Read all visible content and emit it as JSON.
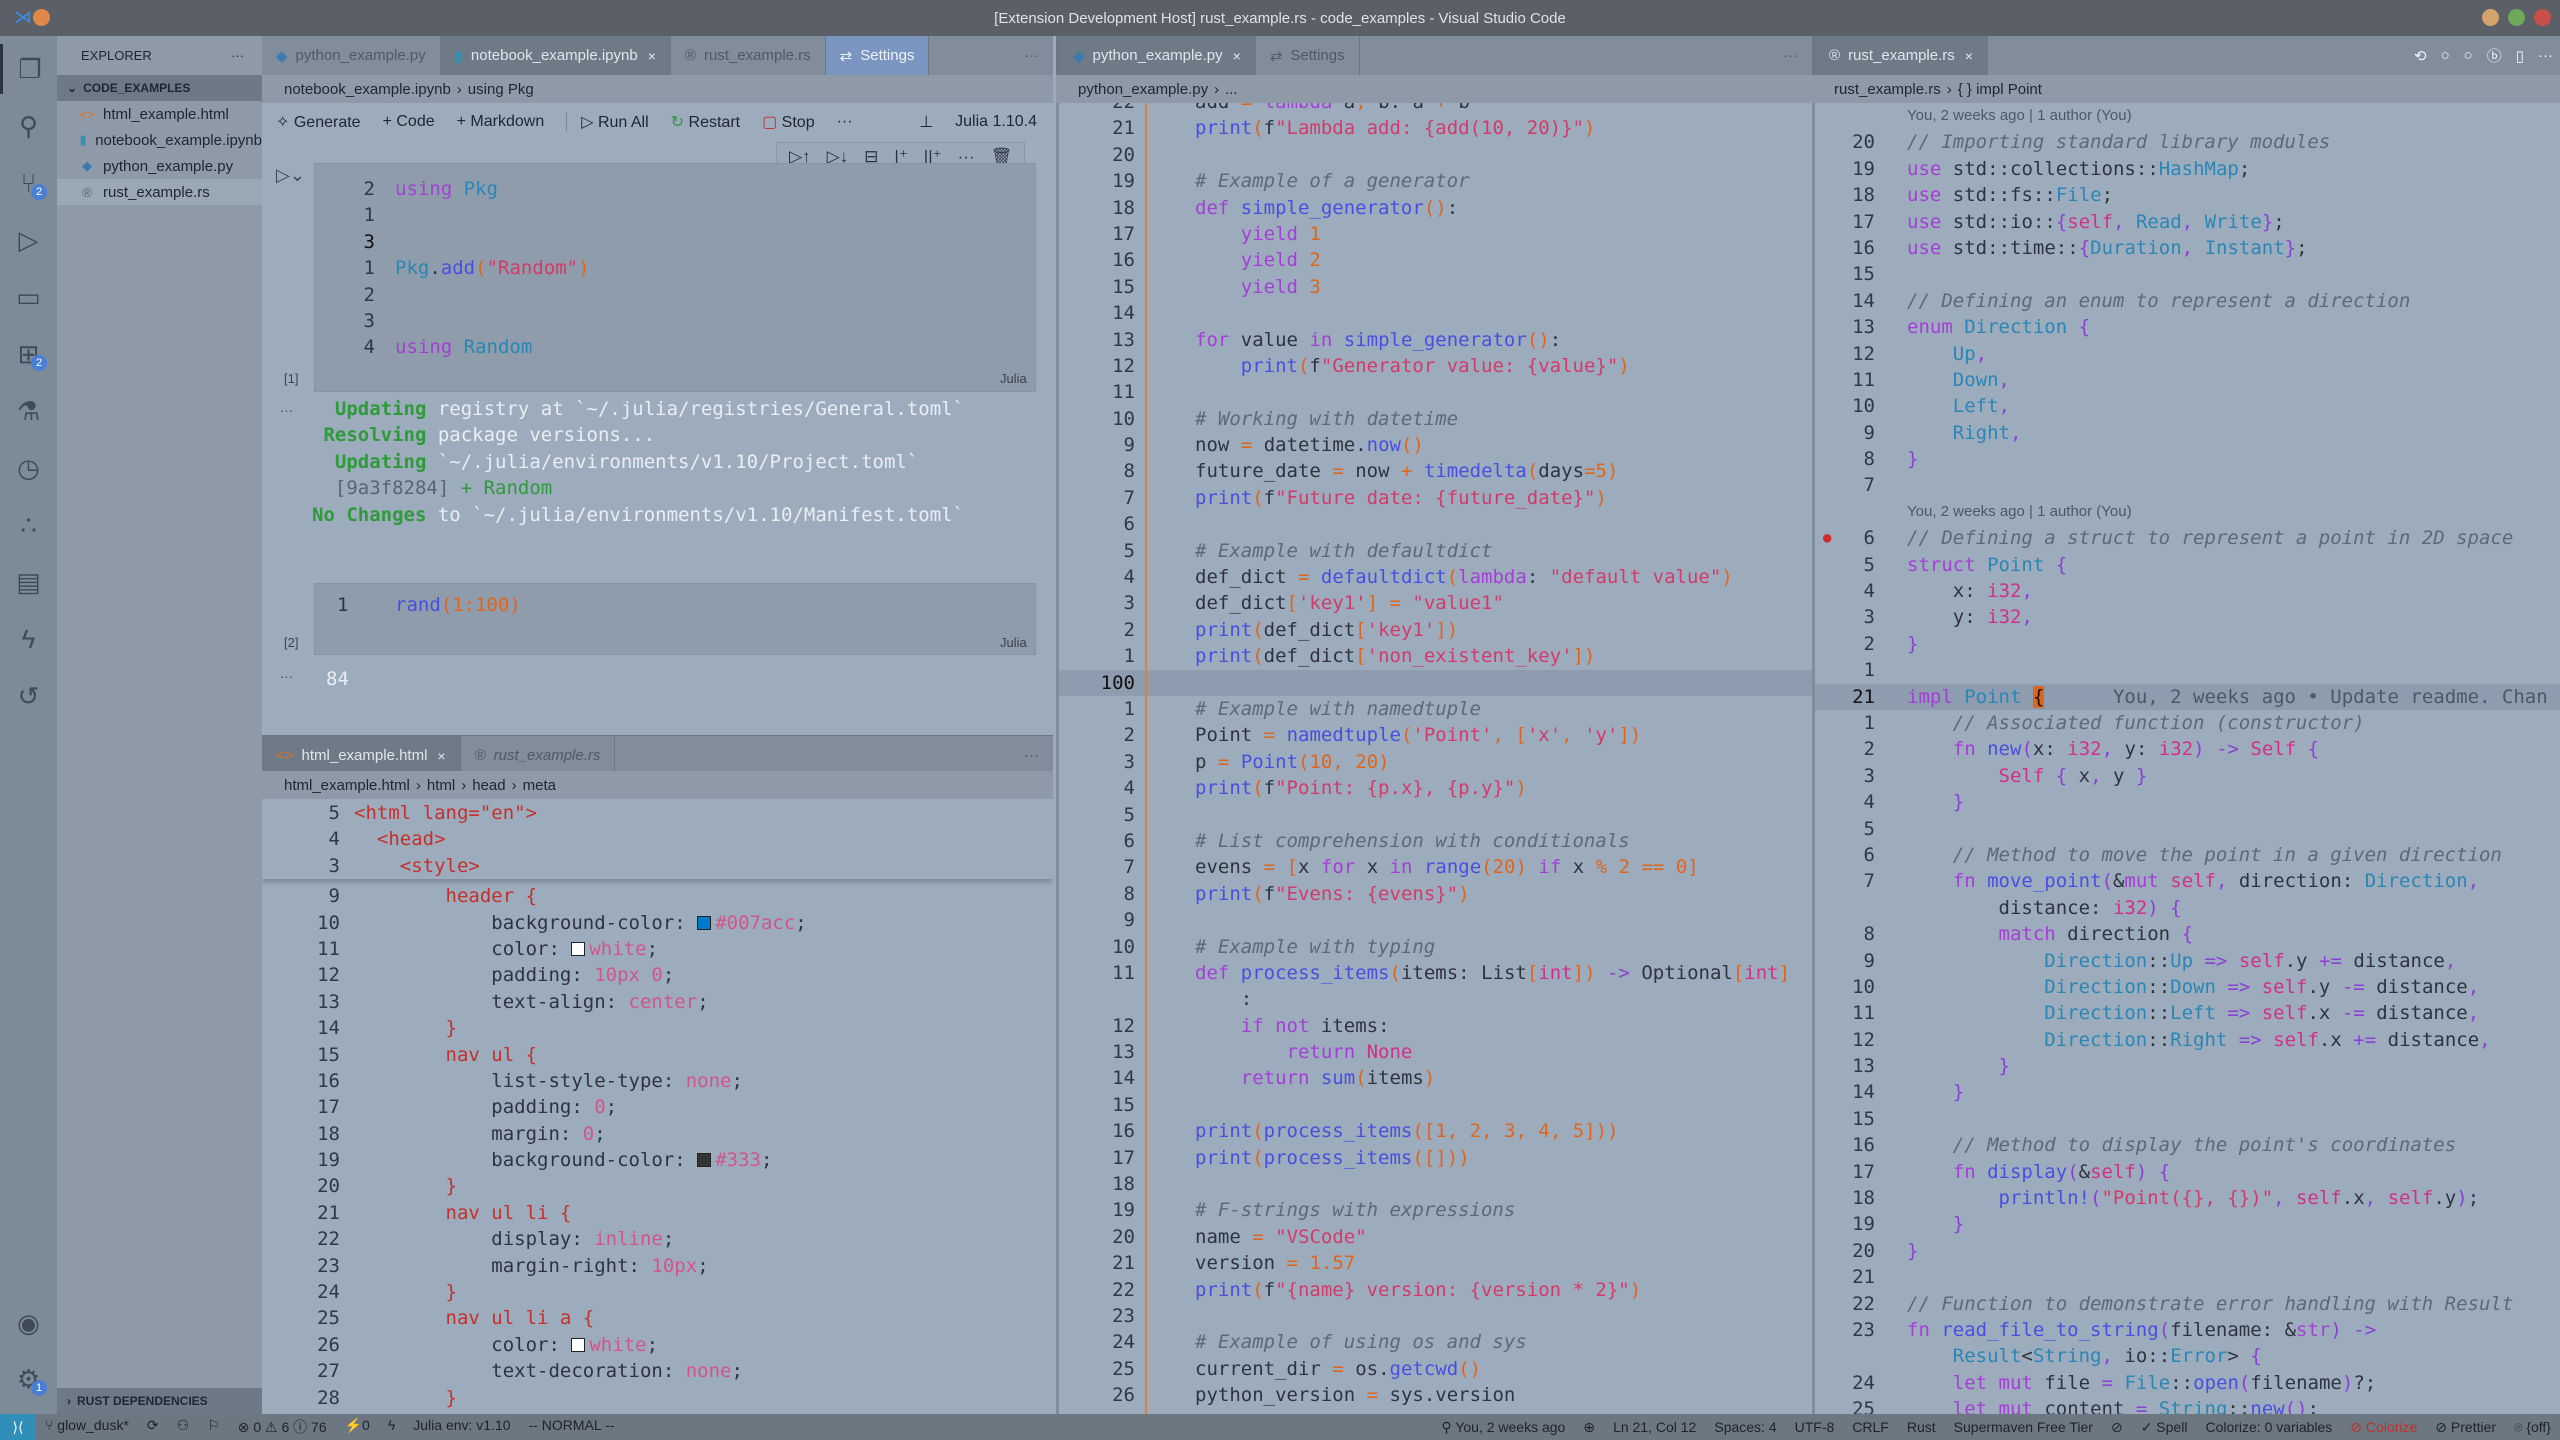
{
  "window": {
    "title": "[Extension Development Host] rust_example.rs - code_examples - Visual Studio Code"
  },
  "activity_bar": {
    "items": [
      "explorer-icon",
      "search-icon",
      "source-control-icon",
      "run-debug-icon",
      "remote-explorer-icon",
      "extensions-icon",
      "testing-icon",
      "timeline-icon",
      "julia-icon",
      "terminal-icon",
      "lightning-icon",
      "history-icon"
    ],
    "scm_badge": "2",
    "ext_badge": "2",
    "settings_badge": "1"
  },
  "sidebar": {
    "title": "EXPLORER",
    "more": "···",
    "section": "CODE_EXAMPLES",
    "files": [
      {
        "name": "html_example.html",
        "icon": "<>",
        "color": "#e07020"
      },
      {
        "name": "notebook_example.ipynb",
        "icon": "▮",
        "color": "#3a8fb0"
      },
      {
        "name": "python_example.py",
        "icon": "◆",
        "color": "#3a7ab0"
      },
      {
        "name": "rust_example.rs",
        "icon": "®",
        "color": "#5d6570"
      }
    ],
    "footer": "RUST DEPENDENCIES"
  },
  "notebook_group": {
    "tabs": [
      {
        "label": "python_example.py",
        "icon": "◆"
      },
      {
        "label": "notebook_example.ipynb",
        "icon": "▮",
        "close": "×"
      },
      {
        "label": "rust_example.rs",
        "icon": "®"
      },
      {
        "label": "Settings",
        "icon": "⇄"
      }
    ],
    "more": "···",
    "breadcrumb": [
      "notebook_example.ipynb",
      "›",
      "using Pkg"
    ],
    "toolbar": {
      "generate": "Generate",
      "code": "+ Code",
      "markdown": "+ Markdown",
      "run_all": "Run All",
      "restart": "Restart",
      "stop": "Stop",
      "more": "···",
      "kernel": "Julia 1.10.4"
    },
    "cell_toolbar": [
      "▷↑",
      "▷↓",
      "⊟",
      "|⁺",
      "||⁺",
      "···",
      "🗑"
    ],
    "cell1": {
      "exec": "[1]",
      "lang": "Julia",
      "lines": [
        {
          "n": "2",
          "t": "using Pkg"
        },
        {
          "n": "1",
          "t": ""
        },
        {
          "n": "3",
          "t": "",
          "cur": true
        },
        {
          "n": "1",
          "t": "Pkg.add(\"Random\")"
        },
        {
          "n": "2",
          "t": ""
        },
        {
          "n": "3",
          "t": ""
        },
        {
          "n": "4",
          "t": "using Random"
        }
      ]
    },
    "output1": [
      {
        "label": "  Updating",
        "text": " registry at `~/.julia/registries/General.toml`"
      },
      {
        "label": " Resolving",
        "text": " package versions..."
      },
      {
        "label": "  Updating",
        "text": " `~/.julia/environments/v1.10/Project.toml`"
      },
      {
        "hash": "  [9a3f8284]",
        "add": " + Random"
      },
      {
        "label": "No Changes",
        "text": " to `~/.julia/environments/v1.10/Manifest.toml`"
      }
    ],
    "cell2": {
      "exec": "[2]",
      "lang": "Julia",
      "line_no": "1",
      "fn": "rand",
      "args": "1:100"
    },
    "output2": "84"
  },
  "html_group": {
    "tabs": [
      {
        "label": "html_example.html",
        "icon": "<>",
        "close": "×"
      },
      {
        "label": "rust_example.rs",
        "icon": "®"
      }
    ],
    "more": "···",
    "breadcrumb": [
      "html_example.html",
      "›",
      "html",
      "›",
      "head",
      "›",
      "meta"
    ],
    "sticky": [
      {
        "n": "5",
        "t": "<html lang=\"en\">"
      },
      {
        "n": "4",
        "t": "  <head>"
      },
      {
        "n": "3",
        "t": "    <style>"
      }
    ],
    "lines": [
      {
        "n": "9",
        "t": "        header {"
      },
      {
        "n": "10",
        "t": "            background-color: #007acc;",
        "sw": "#007acc"
      },
      {
        "n": "11",
        "t": "            color: white;",
        "sw": "#ffffff"
      },
      {
        "n": "12",
        "t": "            padding: 10px 0;"
      },
      {
        "n": "13",
        "t": "            text-align: center;"
      },
      {
        "n": "14",
        "t": "        }"
      },
      {
        "n": "15",
        "t": "        nav ul {"
      },
      {
        "n": "16",
        "t": "            list-style-type: none;"
      },
      {
        "n": "17",
        "t": "            padding: 0;"
      },
      {
        "n": "18",
        "t": "            margin: 0;"
      },
      {
        "n": "19",
        "t": "            background-color: #333;",
        "sw": "#333333"
      },
      {
        "n": "20",
        "t": "        }"
      },
      {
        "n": "21",
        "t": "        nav ul li {"
      },
      {
        "n": "22",
        "t": "            display: inline;"
      },
      {
        "n": "23",
        "t": "            margin-right: 10px;"
      },
      {
        "n": "24",
        "t": "        }"
      },
      {
        "n": "25",
        "t": "        nav ul li a {"
      },
      {
        "n": "26",
        "t": "            color: white;",
        "sw": "#ffffff"
      },
      {
        "n": "27",
        "t": "            text-decoration: none;"
      },
      {
        "n": "28",
        "t": "        }"
      }
    ]
  },
  "python_group": {
    "tabs": [
      {
        "label": "python_example.py",
        "icon": "◆",
        "close": "×"
      },
      {
        "label": "Settings",
        "icon": "⇄"
      }
    ],
    "more": "···",
    "breadcrumb": [
      "python_example.py",
      "›",
      "..."
    ],
    "lines": [
      {
        "n": "22",
        "t": "add = lambda a, b: a + b"
      },
      {
        "n": "21",
        "t": "print(f\"Lambda add: {add(10, 20)}\")"
      },
      {
        "n": "20",
        "t": ""
      },
      {
        "n": "19",
        "t": "# Example of a generator"
      },
      {
        "n": "18",
        "t": "def simple_generator():"
      },
      {
        "n": "17",
        "t": "    yield 1"
      },
      {
        "n": "16",
        "t": "    yield 2"
      },
      {
        "n": "15",
        "t": "    yield 3"
      },
      {
        "n": "14",
        "t": ""
      },
      {
        "n": "13",
        "t": "for value in simple_generator():"
      },
      {
        "n": "12",
        "t": "    print(f\"Generator value: {value}\")"
      },
      {
        "n": "11",
        "t": ""
      },
      {
        "n": "10",
        "t": "# Working with datetime"
      },
      {
        "n": "9",
        "t": "now = datetime.now()"
      },
      {
        "n": "8",
        "t": "future_date = now + timedelta(days=5)"
      },
      {
        "n": "7",
        "t": "print(f\"Future date: {future_date}\")"
      },
      {
        "n": "6",
        "t": ""
      },
      {
        "n": "5",
        "t": "# Example with defaultdict"
      },
      {
        "n": "4",
        "t": "def_dict = defaultdict(lambda: \"default value\")"
      },
      {
        "n": "3",
        "t": "def_dict['key1'] = \"value1\""
      },
      {
        "n": "2",
        "t": "print(def_dict['key1'])"
      },
      {
        "n": "1",
        "t": "print(def_dict['non_existent_key'])"
      },
      {
        "n": "100",
        "t": "",
        "cur": true
      },
      {
        "n": "1",
        "t": "# Example with namedtuple"
      },
      {
        "n": "2",
        "t": "Point = namedtuple('Point', ['x', 'y'])"
      },
      {
        "n": "3",
        "t": "p = Point(10, 20)"
      },
      {
        "n": "4",
        "t": "print(f\"Point: {p.x}, {p.y}\")"
      },
      {
        "n": "5",
        "t": ""
      },
      {
        "n": "6",
        "t": "# List comprehension with conditionals"
      },
      {
        "n": "7",
        "t": "evens = [x for x in range(20) if x % 2 == 0]"
      },
      {
        "n": "8",
        "t": "print(f\"Evens: {evens}\")"
      },
      {
        "n": "9",
        "t": ""
      },
      {
        "n": "10",
        "t": "# Example with typing"
      },
      {
        "n": "11",
        "t": "def process_items(items: List[int]) -> Optional[int]"
      },
      {
        "n": "",
        "t": "    :"
      },
      {
        "n": "12",
        "t": "    if not items:"
      },
      {
        "n": "13",
        "t": "        return None"
      },
      {
        "n": "14",
        "t": "    return sum(items)"
      },
      {
        "n": "15",
        "t": ""
      },
      {
        "n": "16",
        "t": "print(process_items([1, 2, 3, 4, 5]))"
      },
      {
        "n": "17",
        "t": "print(process_items([]))"
      },
      {
        "n": "18",
        "t": ""
      },
      {
        "n": "19",
        "t": "# F-strings with expressions"
      },
      {
        "n": "20",
        "t": "name = \"VSCode\""
      },
      {
        "n": "21",
        "t": "version = 1.57"
      },
      {
        "n": "22",
        "t": "print(f\"{name} version: {version * 2}\")"
      },
      {
        "n": "23",
        "t": ""
      },
      {
        "n": "24",
        "t": "# Example of using os and sys"
      },
      {
        "n": "25",
        "t": "current_dir = os.getcwd()"
      },
      {
        "n": "26",
        "t": "python_version = sys.version"
      }
    ]
  },
  "rust_group": {
    "tabs": [
      {
        "label": "rust_example.rs",
        "icon": "®",
        "close": "×"
      }
    ],
    "actions": [
      "⟲",
      "○",
      "○",
      "ⓑ",
      "▯",
      "···"
    ],
    "breadcrumb": [
      "rust_example.rs",
      "›",
      "{ } impl Point"
    ],
    "lines": [
      {
        "lens": "You, 2 weeks ago | 1 author (You)"
      },
      {
        "n": "20",
        "t": "// Importing standard library modules"
      },
      {
        "n": "19",
        "t": "use std::collections::HashMap;"
      },
      {
        "n": "18",
        "t": "use std::fs::File;"
      },
      {
        "n": "17",
        "t": "use std::io::{self, Read, Write};"
      },
      {
        "n": "16",
        "t": "use std::time::{Duration, Instant};"
      },
      {
        "n": "15",
        "t": ""
      },
      {
        "n": "14",
        "t": "// Defining an enum to represent a direction"
      },
      {
        "n": "13",
        "t": "enum Direction {"
      },
      {
        "n": "12",
        "t": "    Up,"
      },
      {
        "n": "11",
        "t": "    Down,"
      },
      {
        "n": "10",
        "t": "    Left,"
      },
      {
        "n": "9",
        "t": "    Right,"
      },
      {
        "n": "8",
        "t": "}"
      },
      {
        "n": "7",
        "t": ""
      },
      {
        "lens": "You, 2 weeks ago | 1 author (You)"
      },
      {
        "n": "6",
        "t": "// Defining a struct to represent a point in 2D space",
        "bp": true
      },
      {
        "n": "5",
        "t": "struct Point {"
      },
      {
        "n": "4",
        "t": "    x: i32,"
      },
      {
        "n": "3",
        "t": "    y: i32,"
      },
      {
        "n": "2",
        "t": "}"
      },
      {
        "n": "1",
        "t": ""
      },
      {
        "n": "21",
        "t": "impl Point {",
        "cur": true,
        "blame": "You, 2 weeks ago • Update readme. Chan"
      },
      {
        "n": "1",
        "t": "    // Associated function (constructor)"
      },
      {
        "n": "2",
        "t": "    fn new(x: i32, y: i32) -> Self {"
      },
      {
        "n": "3",
        "t": "        Self { x, y }"
      },
      {
        "n": "4",
        "t": "    }"
      },
      {
        "n": "5",
        "t": ""
      },
      {
        "n": "6",
        "t": "    // Method to move the point in a given direction"
      },
      {
        "n": "7",
        "t": "    fn move_point(&mut self, direction: Direction,"
      },
      {
        "n": "",
        "t": "        distance: i32) {"
      },
      {
        "n": "8",
        "t": "        match direction {"
      },
      {
        "n": "9",
        "t": "            Direction::Up => self.y += distance,"
      },
      {
        "n": "10",
        "t": "            Direction::Down => self.y -= distance,"
      },
      {
        "n": "11",
        "t": "            Direction::Left => self.x -= distance,"
      },
      {
        "n": "12",
        "t": "            Direction::Right => self.x += distance,"
      },
      {
        "n": "13",
        "t": "        }"
      },
      {
        "n": "14",
        "t": "    }"
      },
      {
        "n": "15",
        "t": ""
      },
      {
        "n": "16",
        "t": "    // Method to display the point's coordinates"
      },
      {
        "n": "17",
        "t": "    fn display(&self) {"
      },
      {
        "n": "18",
        "t": "        println!(\"Point({}, {})\", self.x, self.y);"
      },
      {
        "n": "19",
        "t": "    }"
      },
      {
        "n": "20",
        "t": "}"
      },
      {
        "n": "21",
        "t": ""
      },
      {
        "n": "22",
        "t": "// Function to demonstrate error handling with Result"
      },
      {
        "n": "23",
        "t": "fn read_file_to_string(filename: &str) ->"
      },
      {
        "n": "",
        "t": "    Result<String, io::Error> {"
      },
      {
        "n": "24",
        "t": "    let mut file = File::open(filename)?;"
      },
      {
        "n": "25",
        "t": "    let mut content = String::new();"
      }
    ]
  },
  "statusbar": {
    "remote": "⟩⟨",
    "left": [
      "⑂ glow_dusk*",
      "⟳",
      "⚇",
      "⚐",
      "⊗ 0 ⚠ 6 ⓘ 76",
      "⚡0",
      "ϟ",
      "Julia env: v1.10",
      "-- NORMAL --"
    ],
    "right": [
      "⚲ You, 2 weeks ago",
      "⊕",
      "Ln 21, Col 12",
      "Spaces: 4",
      "UTF-8",
      "CRLF",
      "Rust",
      "Supermaven Free Tier",
      "⊘",
      "✓ Spell",
      "Colorize: 0 variables",
      "⊘ Colorize",
      "⊘ Prettier",
      "⌾ {off}"
    ],
    "error_color": "#c0302a"
  }
}
